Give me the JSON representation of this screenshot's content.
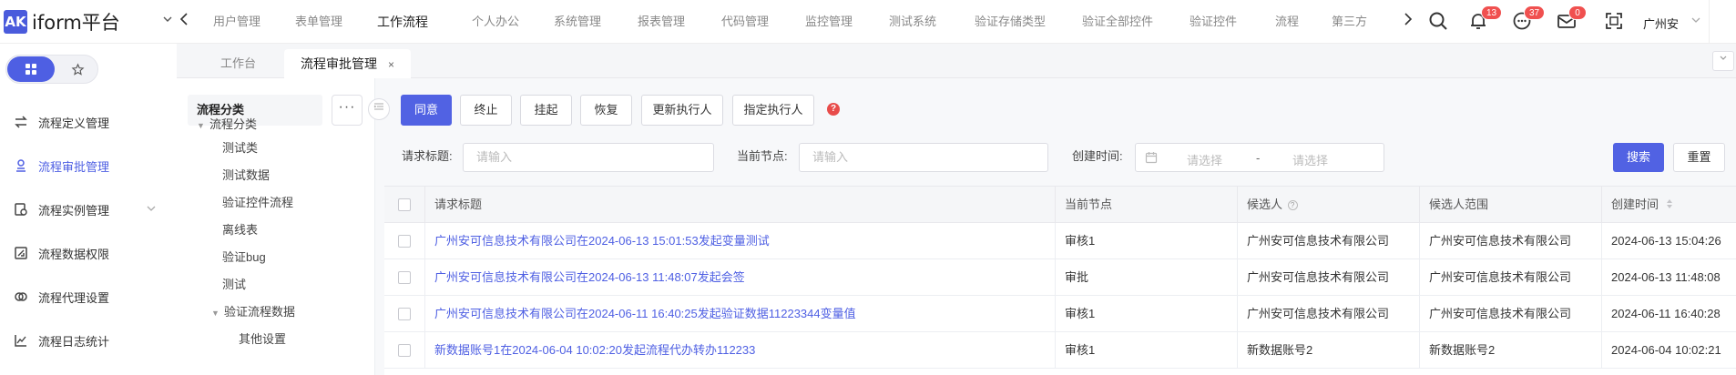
{
  "app": {
    "logo_mark": "AK",
    "title": "iform平台"
  },
  "top_menu": [
    {
      "label": "用户管理",
      "active": false
    },
    {
      "label": "表单管理",
      "active": false
    },
    {
      "label": "工作流程",
      "active": true
    },
    {
      "label": "个人办公",
      "active": false
    },
    {
      "label": "系统管理",
      "active": false
    },
    {
      "label": "报表管理",
      "active": false
    },
    {
      "label": "代码管理",
      "active": false
    },
    {
      "label": "监控管理",
      "active": false
    },
    {
      "label": "测试系统",
      "active": false
    },
    {
      "label": "验证存储类型",
      "active": false
    },
    {
      "label": "验证全部控件",
      "active": false
    },
    {
      "label": "验证控件",
      "active": false
    },
    {
      "label": "流程",
      "active": false
    },
    {
      "label": "第三方",
      "active": false
    }
  ],
  "header_icons": {
    "search": "search-icon",
    "notifications": {
      "icon": "bell-icon",
      "count": "13"
    },
    "messages": {
      "icon": "message-icon",
      "count": "37"
    },
    "mail": {
      "icon": "mail-icon",
      "count": "0"
    },
    "fullscreen": "fullscreen-icon"
  },
  "user": {
    "name": "广州安"
  },
  "colors": {
    "accent": "#5162e3",
    "badge": "#f0504f",
    "link": "#4e5fe3"
  },
  "sidebar": {
    "items": [
      {
        "label": "流程定义管理",
        "icon": "swap-icon",
        "active": false
      },
      {
        "label": "流程审批管理",
        "icon": "approve-icon",
        "active": true
      },
      {
        "label": "流程实例管理",
        "icon": "instance-icon",
        "active": false,
        "expandable": true
      },
      {
        "label": "流程数据权限",
        "icon": "data-permission-icon",
        "active": false
      },
      {
        "label": "流程代理设置",
        "icon": "proxy-icon",
        "active": false
      },
      {
        "label": "流程日志统计",
        "icon": "chart-icon",
        "active": false
      }
    ]
  },
  "tabs": [
    {
      "label": "工作台",
      "active": false
    },
    {
      "label": "流程审批管理",
      "active": true,
      "close": "×"
    }
  ],
  "category_panel": {
    "header": "流程分类",
    "more": "···",
    "tree": [
      {
        "label": "流程分类",
        "level": 0,
        "expanded": true
      },
      {
        "label": "测试类",
        "level": 1
      },
      {
        "label": "测试数据",
        "level": 1
      },
      {
        "label": "验证控件流程",
        "level": 1
      },
      {
        "label": "离线表",
        "level": 1
      },
      {
        "label": "验证bug",
        "level": 1
      },
      {
        "label": "测试",
        "level": 1
      },
      {
        "label": "验证流程数据",
        "level": 1,
        "expanded": true
      },
      {
        "label": "其他设置",
        "level": 2
      }
    ]
  },
  "toolbar": {
    "buttons": [
      "同意",
      "终止",
      "挂起",
      "恢复",
      "更新执行人",
      "指定执行人"
    ],
    "help": "?"
  },
  "filters": {
    "title_label": "请求标题:",
    "title_placeholder": "请输入",
    "node_label": "当前节点:",
    "node_placeholder": "请输入",
    "time_label": "创建时间:",
    "date_start_placeholder": "请选择",
    "date_sep": "-",
    "date_end_placeholder": "请选择",
    "search": "搜索",
    "reset": "重置"
  },
  "table": {
    "columns": [
      "请求标题",
      "当前节点",
      "候选人",
      "候选人范围",
      "创建时间"
    ],
    "rows": [
      {
        "title": "广州安可信息技术有限公司在2024-06-13 15:01:53发起变量测试",
        "node": "审核1",
        "candidate": "广州安可信息技术有限公司",
        "scope": "广州安可信息技术有限公司",
        "time": "2024-06-13 15:04:26"
      },
      {
        "title": "广州安可信息技术有限公司在2024-06-13 11:48:07发起会签",
        "node": "审批",
        "candidate": "广州安可信息技术有限公司",
        "scope": "广州安可信息技术有限公司",
        "time": "2024-06-13 11:48:08"
      },
      {
        "title": "广州安可信息技术有限公司在2024-06-11 16:40:25发起验证数据11223344变量值",
        "node": "审核1",
        "candidate": "广州安可信息技术有限公司",
        "scope": "广州安可信息技术有限公司",
        "time": "2024-06-11 16:40:28"
      },
      {
        "title": "新数据账号1在2024-06-04 10:02:20发起流程代办转办112233",
        "node": "审核1",
        "candidate": "新数据账号2",
        "scope": "新数据账号2",
        "time": "2024-06-04 10:02:21"
      }
    ]
  }
}
